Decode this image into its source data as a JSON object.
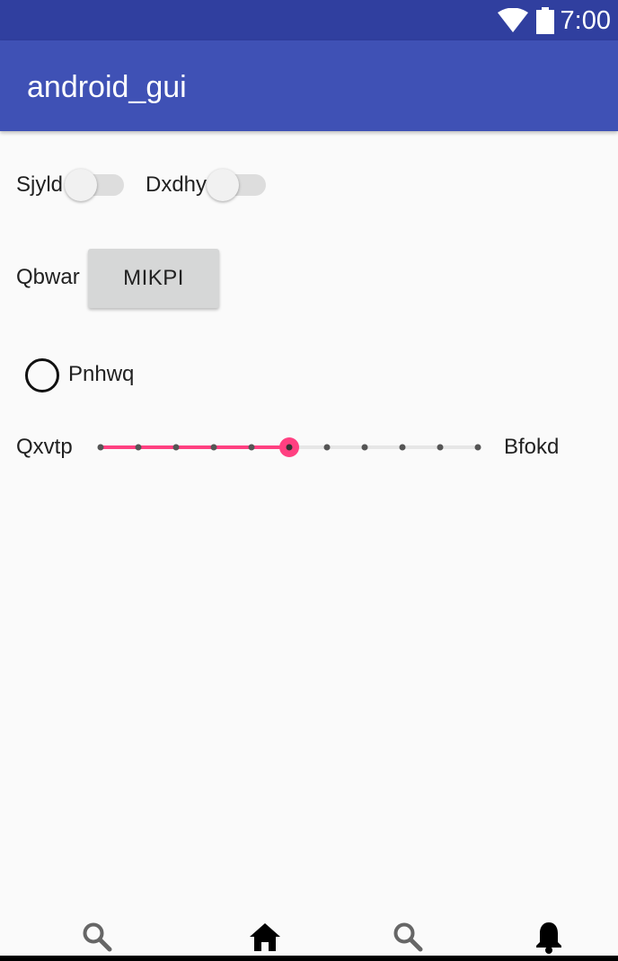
{
  "status_bar": {
    "time": "7:00",
    "icons": [
      "wifi-icon",
      "battery-icon"
    ]
  },
  "app_bar": {
    "title": "android_gui"
  },
  "switches": [
    {
      "label": "Sjyld",
      "checked": false
    },
    {
      "label": "Dxdhy",
      "checked": false
    }
  ],
  "button_row": {
    "label": "Qbwar",
    "button_label": "MIKPI"
  },
  "radio": {
    "label": "Pnhwq",
    "checked": false
  },
  "slider": {
    "left_label": "Qxvtp",
    "right_label": "Bfokd",
    "steps": 10,
    "value": 5,
    "accent": "#FF4081"
  },
  "bottom_nav": {
    "items": [
      "search-icon",
      "home-icon",
      "search-icon",
      "notifications-icon"
    ]
  },
  "colors": {
    "status_bar": "#303F9F",
    "app_bar": "#3F51B5",
    "background": "#FAFAFA",
    "button": "#D6D7D7"
  }
}
